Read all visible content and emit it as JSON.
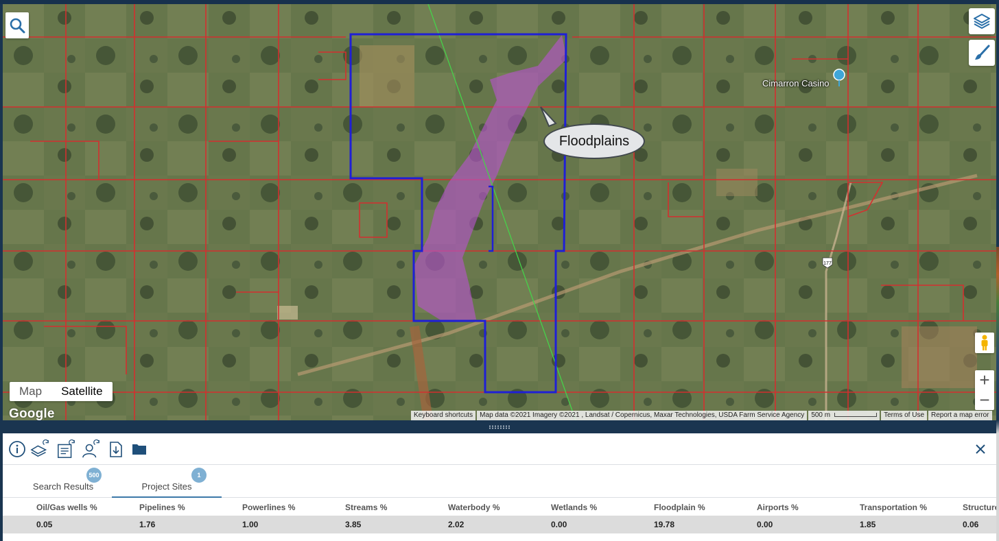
{
  "map": {
    "layers_icon": "layers-icon",
    "draw_icon": "paintbrush-icon",
    "search_icon": "search-icon",
    "maptype": {
      "map_label": "Map",
      "satellite_label": "Satellite",
      "selected": "Satellite"
    },
    "google_logo": "Google",
    "attribution": {
      "shortcuts": "Keyboard shortcuts",
      "data": "Map data ©2021 Imagery ©2021 , Landsat / Copernicus, Maxar Technologies, USDA Farm Service Agency",
      "scale": "500 m",
      "terms": "Terms of Use",
      "report": "Report a map error"
    },
    "callout_label": "Floodplains",
    "poi_label": "Cimarron Casino",
    "route_shield": "177",
    "zoom_in": "+",
    "zoom_out": "−",
    "colors": {
      "parcel": "#d32f2f",
      "site": "#1f1fd6",
      "floodplain": "#b455c8",
      "pipeline": "#46d24a"
    }
  },
  "panel": {
    "toolbar_icons": [
      "info-icon",
      "layers-refresh-icon",
      "report-refresh-icon",
      "contacts-refresh-icon",
      "download-icon",
      "folder-icon"
    ],
    "close_icon": "close-icon",
    "tabs": [
      {
        "label": "Search Results",
        "badge": "500"
      },
      {
        "label": "Project Sites",
        "badge": "1"
      }
    ],
    "active_tab": "Project Sites",
    "table": {
      "columns": [
        "Oil/Gas wells %",
        "Pipelines %",
        "Powerlines %",
        "Streams %",
        "Waterbody %",
        "Wetlands %",
        "Floodplain %",
        "Airports %",
        "Transportation %",
        "Structure"
      ],
      "row": [
        "0.05",
        "1.76",
        "1.00",
        "3.85",
        "2.02",
        "0.00",
        "19.78",
        "0.00",
        "1.85",
        "0.06"
      ]
    }
  }
}
